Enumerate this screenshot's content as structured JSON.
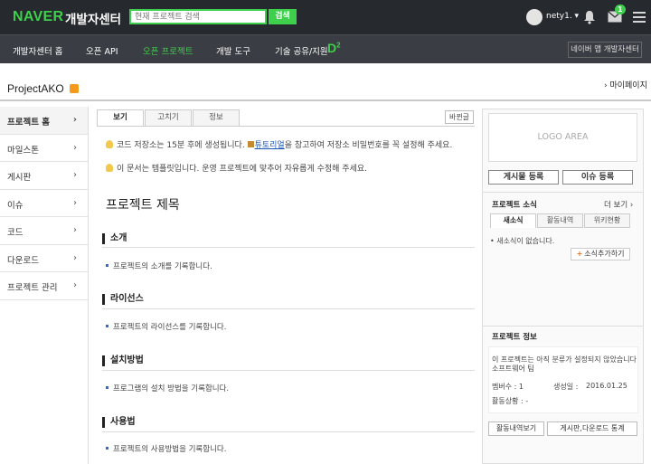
{
  "topbar": {
    "logo": "NAVER",
    "logo_sub": "개발자센터",
    "search_placeholder": "현재 프로젝트 검색",
    "search_button": "검색",
    "username": "nety1.",
    "mail_count": "1"
  },
  "nav": {
    "items": [
      "개발자센터 홈",
      "오픈 API",
      "오픈 프로젝트",
      "개발 도구",
      "기술 공유/지원"
    ],
    "d2_logo": "D",
    "d2_sup": "2",
    "app_center": "네이버 앱 개발자센터"
  },
  "header": {
    "project_title": "ProjectAKO",
    "mypage": "마이페이지"
  },
  "sidebar": {
    "items": [
      "프로젝트 홈",
      "마일스톤",
      "게시판",
      "이슈",
      "코드",
      "다운로드",
      "프로젝트 관리"
    ]
  },
  "main": {
    "tabs": [
      "보기",
      "고치기",
      "정보"
    ],
    "edit_history": "바뀐글",
    "notice1_pre": "코드 저장소는 15분 후에 생성됩니다.",
    "notice1_link": "튜토리얼",
    "notice1_post": "을 참고하여 저장소 비밀번호를 꼭 설정해 주세요.",
    "notice2": "이 문서는 템플릿입니다. 운영 프로젝트에 맞추어 자유롭게 수정해 주세요.",
    "page_title": "프로젝트 제목",
    "sections": [
      {
        "heading": "소개",
        "body": "프로젝트의 소개를 기록합니다."
      },
      {
        "heading": "라이선스",
        "body": "프로젝트의 라이선스를 기록합니다."
      },
      {
        "heading": "설치방법",
        "body": "프로그램의 설치 방법을 기록합니다."
      },
      {
        "heading": "사용법",
        "body": "프로젝트의 사용방법을 기록합니다."
      }
    ]
  },
  "right": {
    "logo_area": "LOGO AREA",
    "bulletin_button": "게시물 등록",
    "issue_button": "이슈 등록",
    "news_heading": "프로젝트 소식",
    "more": "더 보기",
    "news_tabs": [
      "새소식",
      "활동내역",
      "위키현황"
    ],
    "no_news": "새소식이 없습니다.",
    "add_news": "소식추가하기",
    "info_heading": "프로젝트 정보",
    "info_desc": "이 프로젝트는 아직 분류가 설정되지 않았습니다 소프트웨어 팀",
    "members_label": "멤버수 : 1",
    "created_label": "생성일 :",
    "created_value": "2016.01.25",
    "status_label": "활동상황 : -",
    "activity_button": "활동내역보기",
    "stats_button": "게시판,다운로드 통계"
  }
}
